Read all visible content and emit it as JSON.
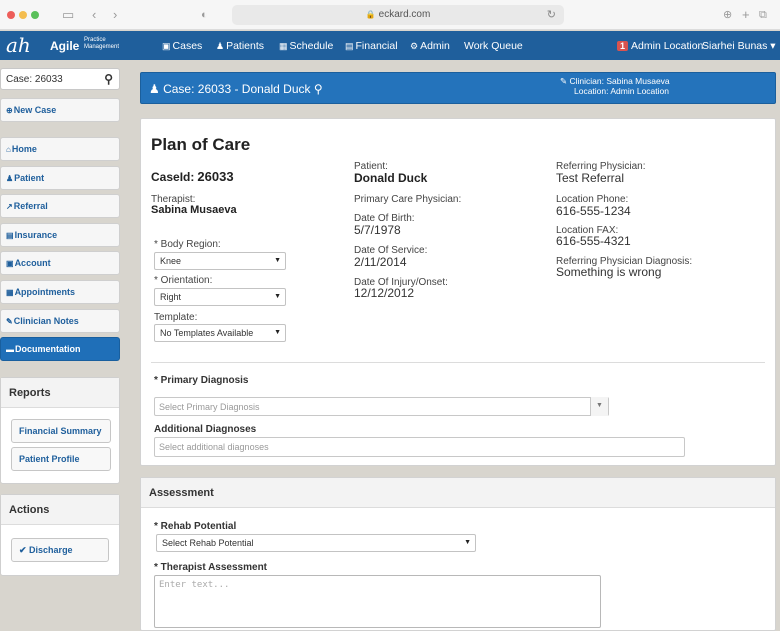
{
  "browser": {
    "url": "eckard.com"
  },
  "topnav": {
    "logo": "ah",
    "brand": "Agile",
    "brand_sub": "Practice Management",
    "items": [
      {
        "icon": "▣",
        "label": "Cases"
      },
      {
        "icon": "♟",
        "label": "Patients"
      },
      {
        "icon": "▦",
        "label": "Schedule"
      },
      {
        "icon": "▤",
        "label": "Financial"
      },
      {
        "icon": "⚙",
        "label": "Admin"
      },
      {
        "icon": "",
        "label": "Work Queue"
      }
    ],
    "location_badge": "1",
    "location": "Admin Location",
    "user": "Siarhei Bunas ▾"
  },
  "sidebar": {
    "search_value": "Case: 26033",
    "new_case": "New Case",
    "items": [
      {
        "icon": "⌂",
        "label": "Home"
      },
      {
        "icon": "♟",
        "label": "Patient"
      },
      {
        "icon": "↗",
        "label": "Referral"
      },
      {
        "icon": "▤",
        "label": "Insurance"
      },
      {
        "icon": "▣",
        "label": "Account"
      },
      {
        "icon": "▦",
        "label": "Appointments"
      },
      {
        "icon": "✎",
        "label": "Clinician Notes"
      },
      {
        "icon": "▬",
        "label": "Documentation"
      }
    ],
    "reports": {
      "title": "Reports",
      "items": [
        "Financial Summary",
        "Patient Profile"
      ]
    },
    "actions": {
      "title": "Actions",
      "discharge": "Discharge"
    }
  },
  "casebar": {
    "title": "Case: 26033 - Donald Duck",
    "clinician": "Clinician: Sabina Musaeva",
    "location": "Location: Admin Location"
  },
  "plan": {
    "title": "Plan of Care",
    "caseid_label": "CaseId:",
    "caseid": "26033",
    "therapist_label": "Therapist:",
    "therapist": "Sabina Musaeva",
    "body_region_label": "* Body Region:",
    "body_region": "Knee",
    "orientation_label": "* Orientation:",
    "orientation": "Right",
    "template_label": "Template:",
    "template": "No Templates Available",
    "patient_label": "Patient:",
    "patient": "Donald Duck",
    "pcp_label": "Primary Care Physician:",
    "dob_label": "Date Of Birth:",
    "dob": "5/7/1978",
    "dos_label": "Date Of Service:",
    "dos": "2/11/2014",
    "doi_label": "Date Of Injury/Onset:",
    "doi": "12/12/2012",
    "ref_phys_label": "Referring Physician:",
    "ref_phys": "Test Referral",
    "loc_phone_label": "Location Phone:",
    "loc_phone": "616-555-1234",
    "loc_fax_label": "Location FAX:",
    "loc_fax": "616-555-4321",
    "ref_dx_label": "Referring Physician Diagnosis:",
    "ref_dx": "Something is wrong",
    "primary_dx_label": "* Primary Diagnosis",
    "primary_dx_placeholder": "Select Primary Diagnosis",
    "additional_dx_label": "Additional Diagnoses",
    "additional_dx_placeholder": "Select additional diagnoses"
  },
  "assessment": {
    "title": "Assessment",
    "rehab_label": "* Rehab Potential",
    "rehab_value": "Select Rehab Potential",
    "therapist_assessment_label": "* Therapist Assessment",
    "therapist_assessment_placeholder": "Enter text..."
  }
}
